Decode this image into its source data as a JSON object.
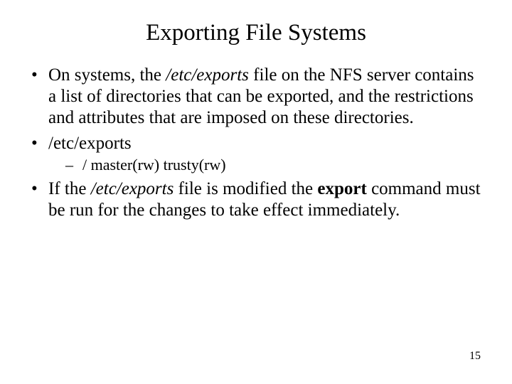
{
  "title": "Exporting File Systems",
  "b1": {
    "a": "On systems, the ",
    "b": "/etc/exports",
    "c": " file on the NFS server contains a list of directories that can be exported, and the restrictions and attributes that are imposed on these directories."
  },
  "b2": "/etc/exports",
  "sub1": "/   master(rw) trusty(rw)",
  "b3": {
    "a": "If the ",
    "b": "/etc/exports",
    "c": " file is modified the ",
    "d": "export",
    "e": " command must be run for the changes to take effect immediately."
  },
  "page_number": "15"
}
